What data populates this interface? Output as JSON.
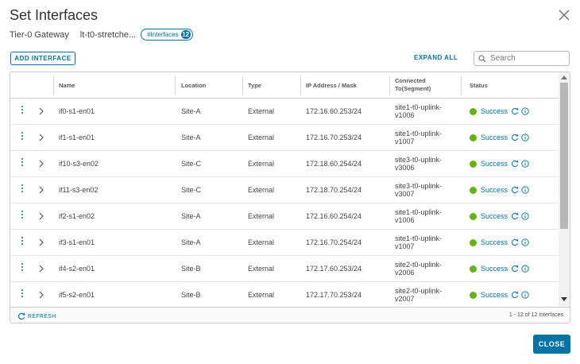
{
  "dialog": {
    "title": "Set Interfaces",
    "gateway_label": "Tier-0 Gateway",
    "gateway_name": "lt-t0-stretche...",
    "pill_label": "#Interfaces",
    "pill_count": "12"
  },
  "toolbar": {
    "add_label": "ADD INTERFACE",
    "expand_all_label": "EXPAND ALL",
    "search_placeholder": "Search"
  },
  "table": {
    "columns": [
      "Name",
      "Location",
      "Type",
      "IP Address / Mask",
      "Connected To(Segment)",
      "Status"
    ],
    "rows": [
      {
        "name": "if0-s1-en01",
        "location": "Site-A",
        "type": "External",
        "ip": "172.16.60.253/24",
        "segment": "site1-t0-uplink-v1006",
        "status": "Success"
      },
      {
        "name": "if1-s1-en01",
        "location": "Site-A",
        "type": "External",
        "ip": "172.16.70.253/24",
        "segment": "site1-t0-uplink-v1007",
        "status": "Success"
      },
      {
        "name": "if10-s3-en02",
        "location": "Site-C",
        "type": "External",
        "ip": "172.18.60.254/24",
        "segment": "site3-t0-uplink-v3006",
        "status": "Success"
      },
      {
        "name": "if11-s3-en02",
        "location": "Site-C",
        "type": "External",
        "ip": "172.18.70.254/24",
        "segment": "site3-t0-uplink-v3007",
        "status": "Success"
      },
      {
        "name": "if2-s1-en02",
        "location": "Site-A",
        "type": "External",
        "ip": "172.16.60.254/24",
        "segment": "site1-t0-uplink-v1006",
        "status": "Success"
      },
      {
        "name": "if3-s1-en01",
        "location": "Site-A",
        "type": "External",
        "ip": "172.16.70.254/24",
        "segment": "site1-t0-uplink-v1007",
        "status": "Success"
      },
      {
        "name": "if4-s2-en01",
        "location": "Site-B",
        "type": "External",
        "ip": "172.17.60.253/24",
        "segment": "site2-t0-uplink-v2006",
        "status": "Success"
      },
      {
        "name": "if5-s2-en01",
        "location": "Site-B",
        "type": "External",
        "ip": "172.17.70.253/24",
        "segment": "site2-t0-uplink-v2007",
        "status": "Success"
      }
    ]
  },
  "footer": {
    "refresh_label": "REFRESH",
    "pager_text": "1 - 12 of 12 Interfaces"
  },
  "actions": {
    "close_label": "CLOSE"
  },
  "colors": {
    "accent": "#0072a3",
    "success": "#60b515"
  }
}
